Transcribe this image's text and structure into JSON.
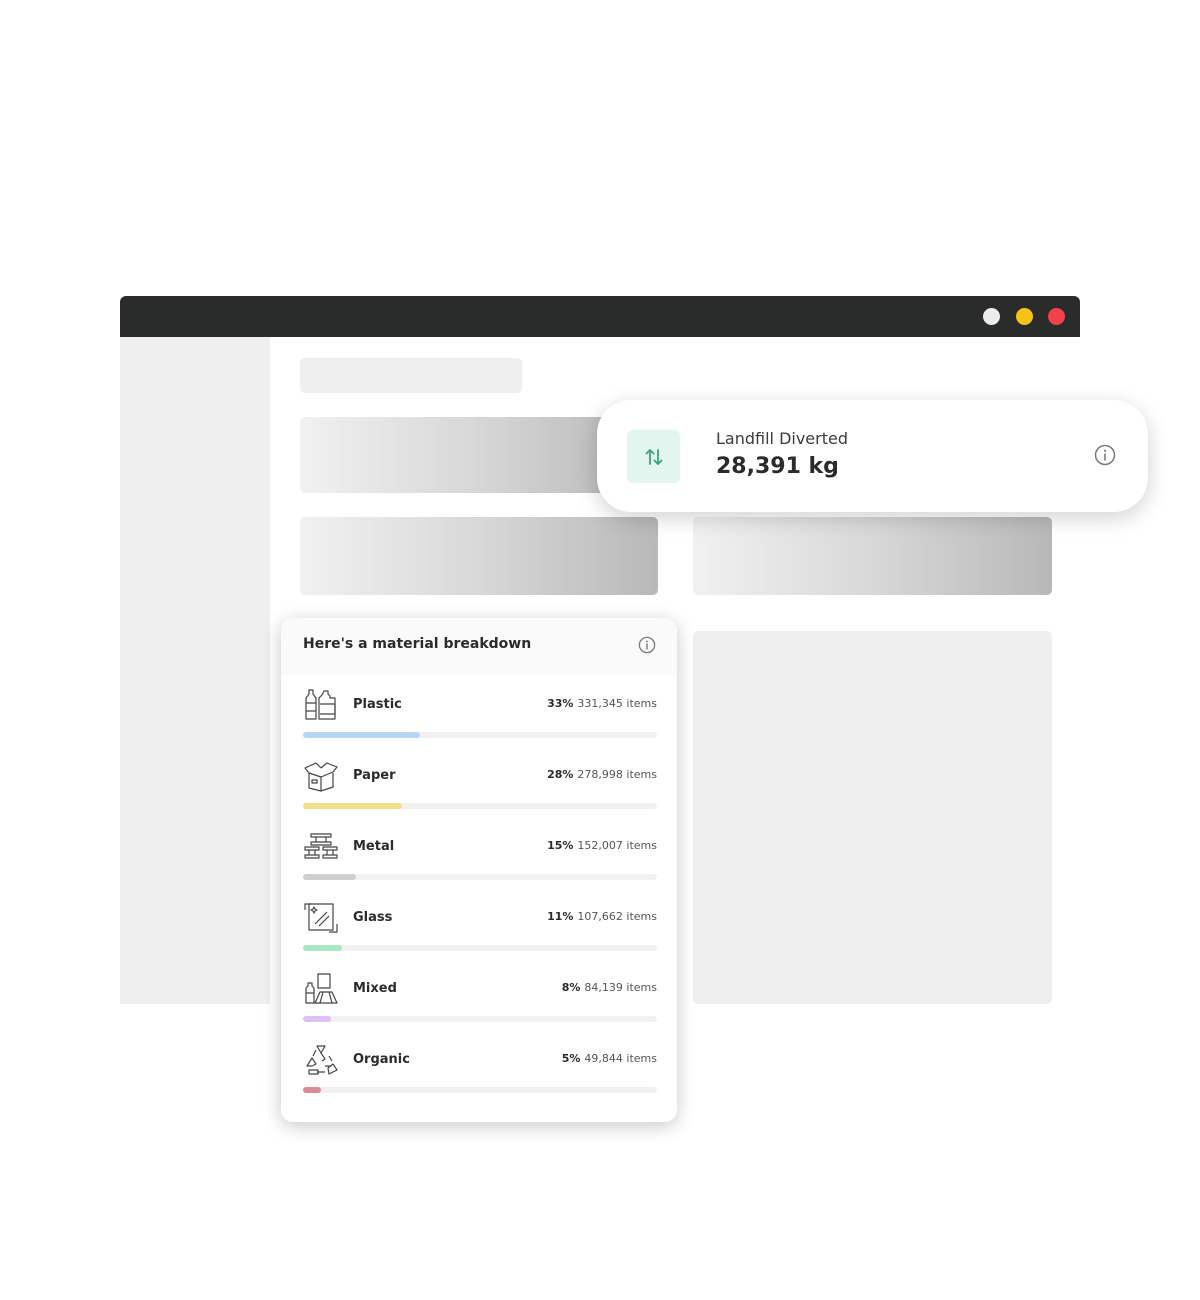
{
  "window": {
    "dots": [
      {
        "name": "window-dot-white",
        "color": "#ececec"
      },
      {
        "name": "window-dot-yellow",
        "color": "#f5c313"
      },
      {
        "name": "window-dot-red",
        "color": "#f2414a"
      }
    ]
  },
  "stat_card": {
    "icon": "swap-vertical-arrows-icon",
    "label": "Landfill Diverted",
    "value": "28,391 kg",
    "info_icon": "info-icon"
  },
  "breakdown": {
    "title": "Here's a material breakdown",
    "info_icon": "info-icon",
    "materials": [
      {
        "name": "Plastic",
        "percent": "33%",
        "items": "331,345 items",
        "fraction": 0.33,
        "color": "#b7d4f7",
        "icon": "plastic-bottles-icon"
      },
      {
        "name": "Paper",
        "percent": "28%",
        "items": "278,998 items",
        "fraction": 0.28,
        "color": "#f4e08a",
        "icon": "cardboard-box-icon"
      },
      {
        "name": "Metal",
        "percent": "15%",
        "items": "152,007 items",
        "fraction": 0.15,
        "color": "#cfcfcf",
        "icon": "metal-beams-icon"
      },
      {
        "name": "Glass",
        "percent": "11%",
        "items": "107,662 items",
        "fraction": 0.11,
        "color": "#a9e6c4",
        "icon": "glass-pane-icon"
      },
      {
        "name": "Mixed",
        "percent": "8%",
        "items": "84,139 items",
        "fraction": 0.08,
        "color": "#dcc2f4",
        "icon": "mixed-materials-icon"
      },
      {
        "name": "Organic",
        "percent": "5%",
        "items": "49,844 items",
        "fraction": 0.05,
        "color": "#d98a97",
        "icon": "recycle-icon"
      }
    ]
  }
}
